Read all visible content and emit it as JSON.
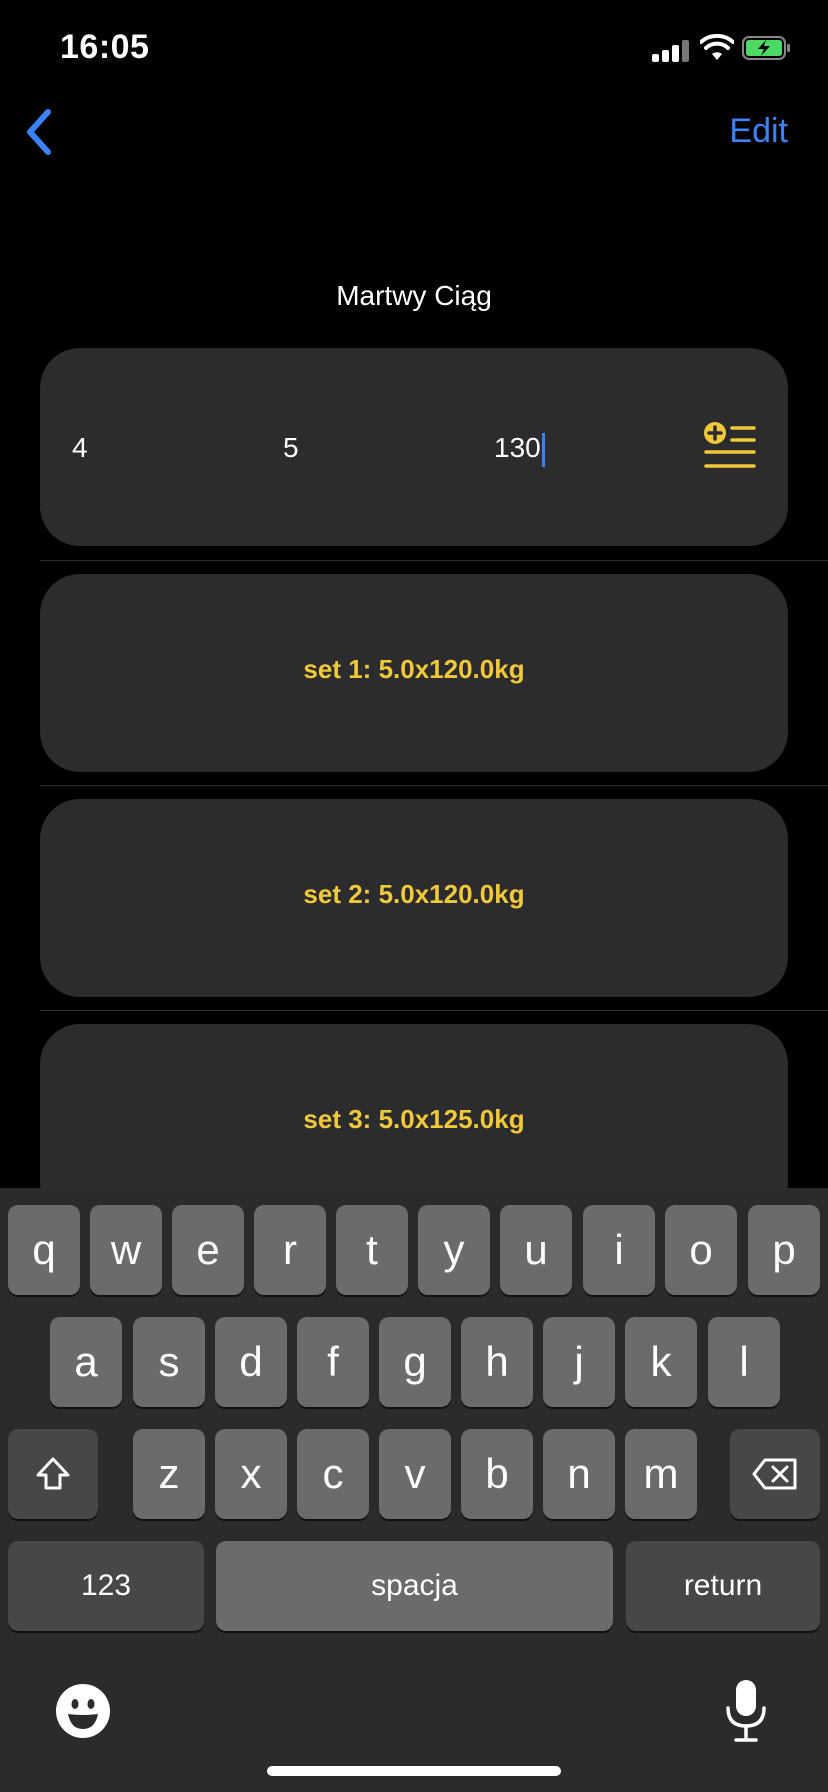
{
  "status_bar": {
    "time": "16:05",
    "icons": [
      "cellular-signal-icon",
      "wifi-icon",
      "battery-charging-icon"
    ]
  },
  "nav": {
    "back_icon": "chevron-left-icon",
    "edit_label": "Edit"
  },
  "exercise_title": "Martwy Ciąg",
  "input_row": {
    "sets_value": "4",
    "reps_value": "5",
    "weight_value": "130",
    "add_icon": "add-list-icon"
  },
  "sets": [
    {
      "label": "set 1: 5.0x120.0kg"
    },
    {
      "label": "set 2: 5.0x120.0kg"
    },
    {
      "label": "set 3: 5.0x125.0kg"
    }
  ],
  "keyboard": {
    "row1": [
      "q",
      "w",
      "e",
      "r",
      "t",
      "y",
      "u",
      "i",
      "o",
      "p"
    ],
    "row2": [
      "a",
      "s",
      "d",
      "f",
      "g",
      "h",
      "j",
      "k",
      "l"
    ],
    "row3": [
      "z",
      "x",
      "c",
      "v",
      "b",
      "n",
      "m"
    ],
    "numbers_label": "123",
    "space_label": "spacja",
    "return_label": "return",
    "shift_icon": "shift-icon",
    "delete_icon": "backspace-icon",
    "emoji_icon": "emoji-icon",
    "mic_icon": "microphone-icon"
  },
  "colors": {
    "accent_blue": "#3b82f6",
    "accent_yellow": "#f0c93a",
    "card": "#2c2c2e"
  }
}
